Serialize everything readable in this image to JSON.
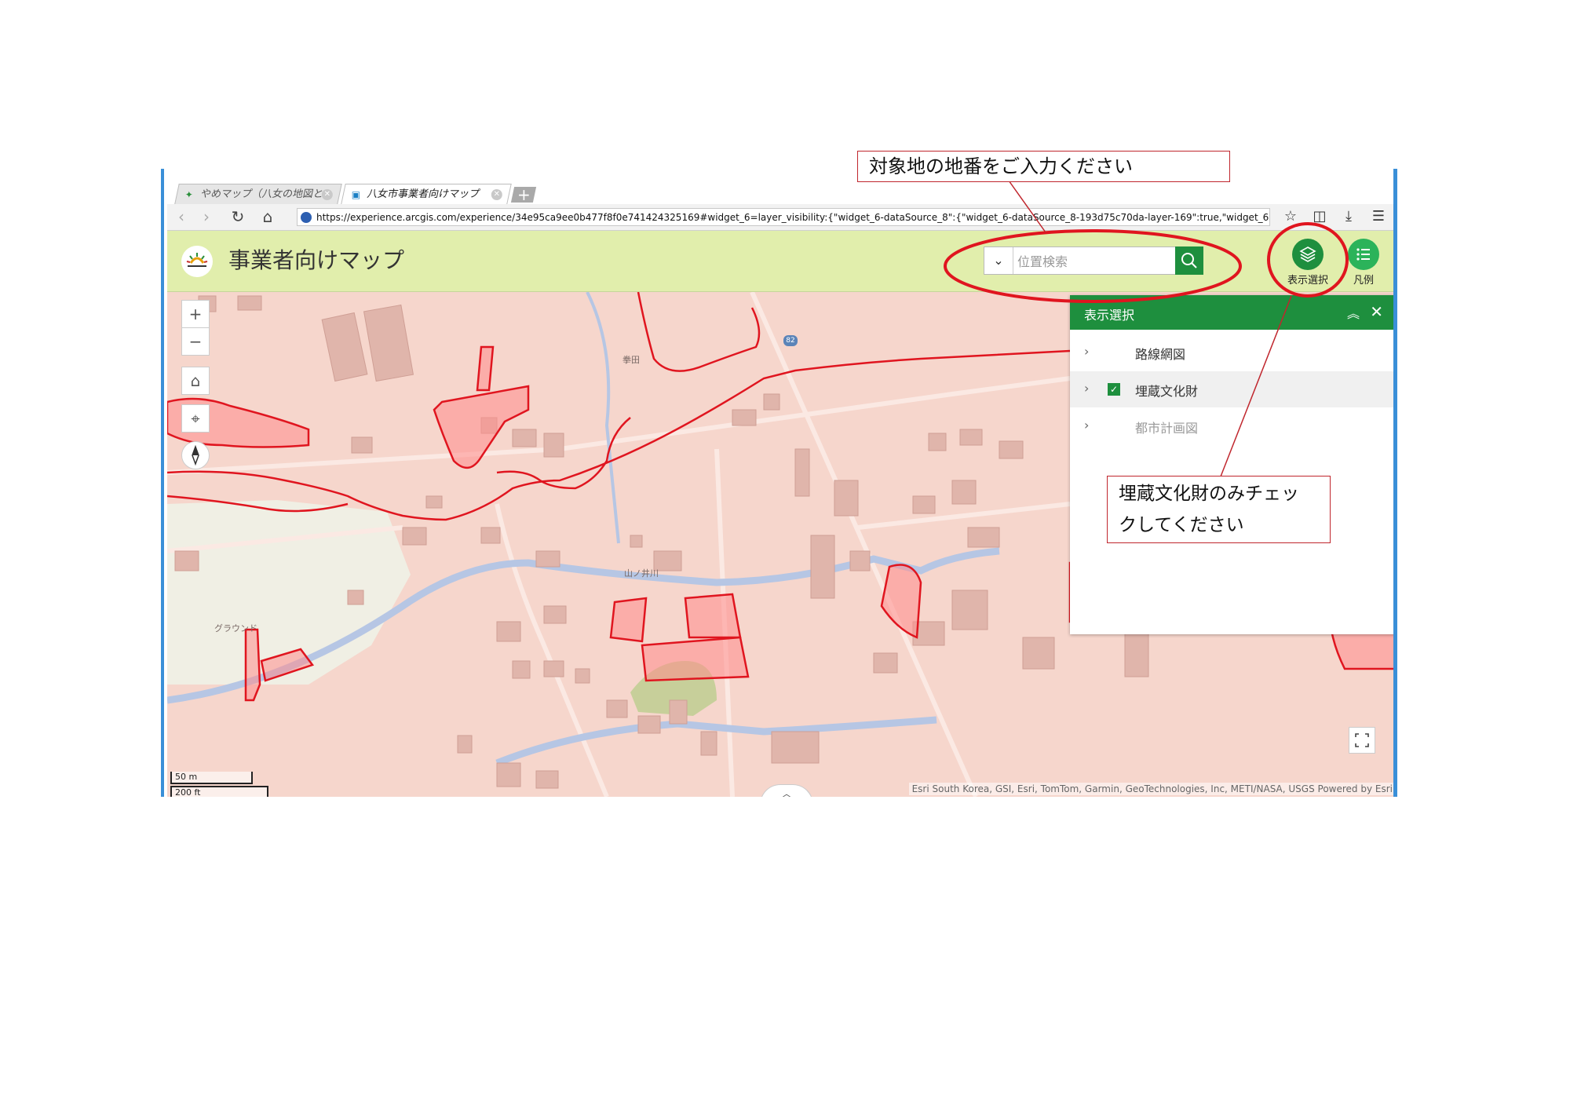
{
  "browser": {
    "tabs": [
      {
        "label": "やめマップ（八女の地図と",
        "active": false
      },
      {
        "label": "八女市事業者向けマップ",
        "active": true
      }
    ],
    "new_tab_label": "+",
    "url": "https://experience.arcgis.com/experience/34e95ca9ee0b477f8f0e741424325169#widget_6=layer_visibility:{\"widget_6-dataSource_8\":{\"widget_6-dataSource_8-193d75c70da-layer-169\":true,\"widget_6"
  },
  "app": {
    "title": "事業者向けマップ",
    "search_placeholder": "位置検索",
    "buttons": [
      {
        "label": "表示選択",
        "icon": "layers-icon"
      },
      {
        "label": "凡例",
        "icon": "list-icon"
      }
    ]
  },
  "map": {
    "labels": [
      "拳田",
      "山ノ井川",
      "グラウンド",
      "82"
    ],
    "scale": {
      "metric": "50 m",
      "imperial": "200 ft"
    },
    "attribution": "Esri South Korea, GSI, Esri, TomTom, Garmin, GeoTechnologies, Inc, METI/NASA, USGS    Powered by Esri",
    "controls": [
      "+",
      "−"
    ]
  },
  "layer_panel": {
    "title": "表示選択",
    "layers": [
      {
        "label": "路線網図",
        "checked": false,
        "enabled": true
      },
      {
        "label": "埋蔵文化財",
        "checked": true,
        "enabled": true
      },
      {
        "label": "都市計画図",
        "checked": false,
        "enabled": false
      }
    ]
  },
  "annotations": {
    "top_note": "対象地の地番をご入力ください",
    "side_note_line1": "埋蔵文化財のみチェッ",
    "side_note_line2": "クしてください",
    "highlight_color": "#e0151f"
  }
}
